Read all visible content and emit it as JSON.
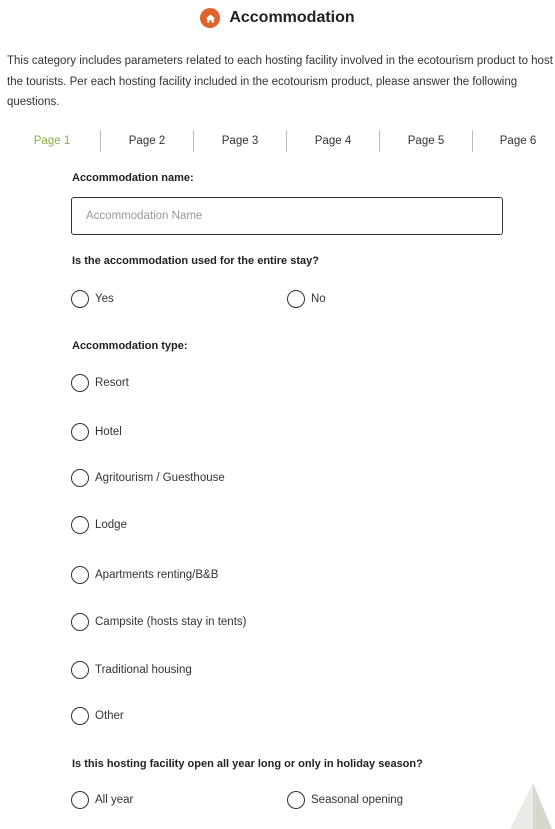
{
  "header": {
    "title": "Accommodation",
    "icon": "home-icon",
    "icon_color": "#e0642d"
  },
  "intro": {
    "text": "This category includes parameters related to each hosting facility involved in the ecotourism product to host the tourists. Per each hosting facility included in the ecotourism product, please answer the following questions."
  },
  "pagination": {
    "active_color": "#8cb04a",
    "pages": [
      {
        "label": "Page 1",
        "active": true
      },
      {
        "label": "Page 2",
        "active": false
      },
      {
        "label": "Page 3",
        "active": false
      },
      {
        "label": "Page 4",
        "active": false
      },
      {
        "label": "Page 5",
        "active": false
      },
      {
        "label": "Page 6",
        "active": false
      }
    ]
  },
  "form": {
    "name": {
      "label": "Accommodation name:",
      "placeholder": "Accommodation Name",
      "value": ""
    },
    "entire_stay": {
      "label": "Is the accommodation used for the entire stay?",
      "options": [
        "Yes",
        "No"
      ],
      "selected": null
    },
    "type": {
      "label": "Accommodation type:",
      "options": [
        "Resort",
        "Hotel",
        "Agritourism / Guesthouse",
        "Lodge",
        "Apartments renting/B&B",
        "Campsite (hosts stay in tents)",
        "Traditional housing",
        "Other"
      ],
      "selected": null
    },
    "season": {
      "label": "Is this hosting facility open all year long or only in holiday season?",
      "options": [
        "All year",
        "Seasonal opening"
      ],
      "selected": null
    }
  }
}
